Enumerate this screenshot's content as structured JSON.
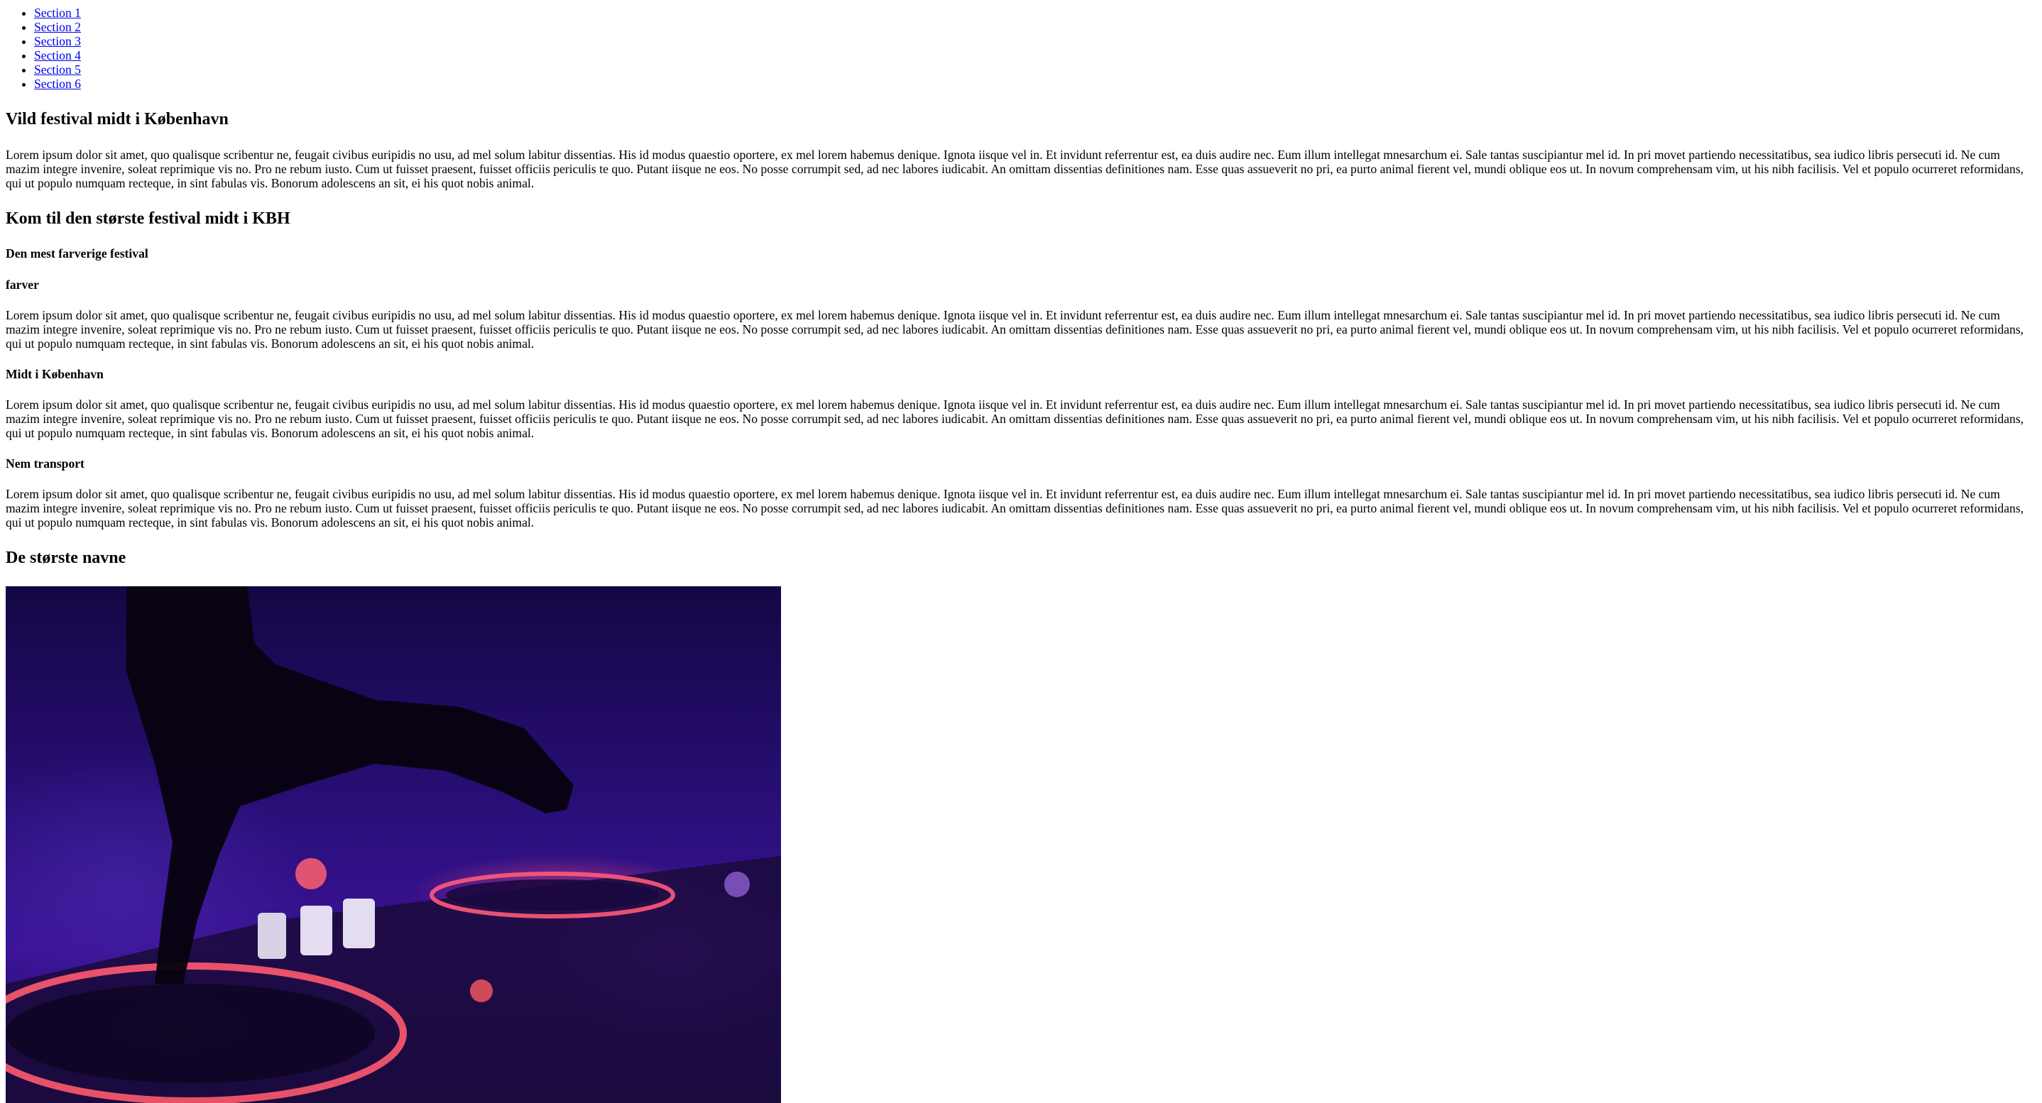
{
  "nav": {
    "items": [
      "Section 1",
      "Section 2",
      "Section 3",
      "Section 4",
      "Section 5",
      "Section 6"
    ]
  },
  "sections": {
    "title_1": "Vild festival midt i København",
    "paragraph_1": "Lorem ipsum dolor sit amet, quo qualisque scribentur ne, feugait civibus euripidis no usu, ad mel solum labitur dissentias. His id modus quaestio oportere, ex mel lorem habemus denique. Ignota iisque vel in. Et invidunt referrentur est, ea duis audire nec. Eum illum intellegat mnesarchum ei. Sale tantas suscipiantur mel id. In pri movet partiendo necessitatibus, sea iudico libris persecuti id. Ne cum mazim integre invenire, soleat reprimique vis no. Pro ne rebum iusto. Cum ut fuisset praesent, fuisset officiis periculis te quo. Putant iisque ne eos. No posse corrumpit sed, ad nec labores iudicabit. An omittam dissentias definitiones nam. Esse quas assueverit no pri, ea purto animal fierent vel, mundi oblique eos ut. In novum comprehensam vim, ut his nibh facilisis. Vel et populo ocurreret reformidans, qui ut populo numquam recteque, in sint fabulas vis. Bonorum adolescens an sit, ei his quot nobis animal.",
    "title_2": "Kom til den største festival midt i KBH",
    "subtitle_1": "Den mest farverige festival",
    "subtitle_2": "farver",
    "paragraph_2": "Lorem ipsum dolor sit amet, quo qualisque scribentur ne, feugait civibus euripidis no usu, ad mel solum labitur dissentias. His id modus quaestio oportere, ex mel lorem habemus denique. Ignota iisque vel in. Et invidunt referrentur est, ea duis audire nec. Eum illum intellegat mnesarchum ei. Sale tantas suscipiantur mel id. In pri movet partiendo necessitatibus, sea iudico libris persecuti id. Ne cum mazim integre invenire, soleat reprimique vis no. Pro ne rebum iusto. Cum ut fuisset praesent, fuisset officiis periculis te quo. Putant iisque ne eos. No posse corrumpit sed, ad nec labores iudicabit. An omittam dissentias definitiones nam. Esse quas assueverit no pri, ea purto animal fierent vel, mundi oblique eos ut. In novum comprehensam vim, ut his nibh facilisis. Vel et populo ocurreret reformidans, qui ut populo numquam recteque, in sint fabulas vis. Bonorum adolescens an sit, ei his quot nobis animal.",
    "subtitle_3": "Midt i København",
    "paragraph_3": "Lorem ipsum dolor sit amet, quo qualisque scribentur ne, feugait civibus euripidis no usu, ad mel solum labitur dissentias. His id modus quaestio oportere, ex mel lorem habemus denique. Ignota iisque vel in. Et invidunt referrentur est, ea duis audire nec. Eum illum intellegat mnesarchum ei. Sale tantas suscipiantur mel id. In pri movet partiendo necessitatibus, sea iudico libris persecuti id. Ne cum mazim integre invenire, soleat reprimique vis no. Pro ne rebum iusto. Cum ut fuisset praesent, fuisset officiis periculis te quo. Putant iisque ne eos. No posse corrumpit sed, ad nec labores iudicabit. An omittam dissentias definitiones nam. Esse quas assueverit no pri, ea purto animal fierent vel, mundi oblique eos ut. In novum comprehensam vim, ut his nibh facilisis. Vel et populo ocurreret reformidans, qui ut populo numquam recteque, in sint fabulas vis. Bonorum adolescens an sit, ei his quot nobis animal.",
    "subtitle_4": "Nem transport",
    "paragraph_4": "Lorem ipsum dolor sit amet, quo qualisque scribentur ne, feugait civibus euripidis no usu, ad mel solum labitur dissentias. His id modus quaestio oportere, ex mel lorem habemus denique. Ignota iisque vel in. Et invidunt referrentur est, ea duis audire nec. Eum illum intellegat mnesarchum ei. Sale tantas suscipiantur mel id. In pri movet partiendo necessitatibus, sea iudico libris persecuti id. Ne cum mazim integre invenire, soleat reprimique vis no. Pro ne rebum iusto. Cum ut fuisset praesent, fuisset officiis periculis te quo. Putant iisque ne eos. No posse corrumpit sed, ad nec labores iudicabit. An omittam dissentias definitiones nam. Esse quas assueverit no pri, ea purto animal fierent vel, mundi oblique eos ut. In novum comprehensam vim, ut his nibh facilisis. Vel et populo ocurreret reformidans, qui ut populo numquam recteque, in sint fabulas vis. Bonorum adolescens an sit, ei his quot nobis animal.",
    "title_3": "De største navne"
  },
  "colors": {
    "link": "#0000ee",
    "text": "#000000",
    "background": "#ffffff"
  }
}
